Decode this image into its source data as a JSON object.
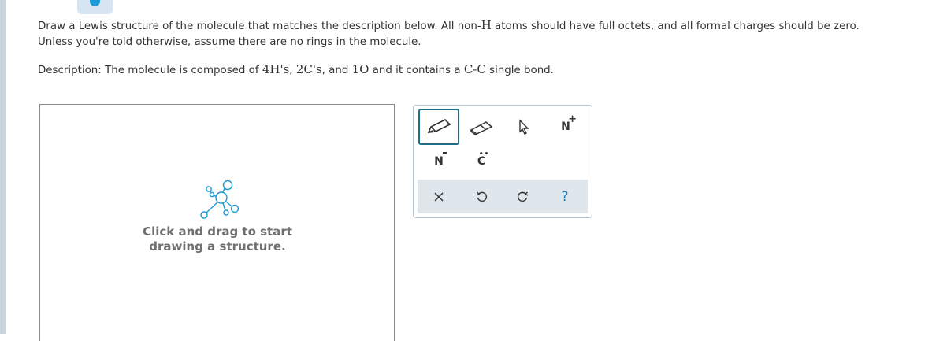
{
  "instructions": {
    "line1_a": "Draw a Lewis structure of the molecule that matches the description below. All non-",
    "line1_h": "H",
    "line1_b": " atoms should have full octets, and all formal charges should be zero.",
    "line2": "Unless you're told otherwise, assume there are no rings in the molecule.",
    "desc_a": "Description: The molecule is composed of ",
    "desc_h": "4H's",
    "desc_sep1": ", ",
    "desc_c": "2C's",
    "desc_sep2": ", and ",
    "desc_o": "1O",
    "desc_b": " and it contains a ",
    "desc_bond": "C-C",
    "desc_c2": " single bond."
  },
  "canvas": {
    "placeholder_line1": "Click and drag to start",
    "placeholder_line2": "drawing a structure."
  },
  "toolbar": {
    "tools": [
      {
        "id": "pencil",
        "icon": "pencil-icon",
        "active": true
      },
      {
        "id": "eraser",
        "icon": "eraser-icon"
      },
      {
        "id": "select",
        "icon": "cursor-icon"
      },
      {
        "id": "positive-charge",
        "label": "N",
        "superscript": "+"
      },
      {
        "id": "lone-pair",
        "label": "N"
      },
      {
        "id": "radical",
        "label": "C"
      }
    ],
    "actions": [
      {
        "id": "clear",
        "icon": "x-icon"
      },
      {
        "id": "undo",
        "icon": "undo-icon"
      },
      {
        "id": "redo",
        "icon": "redo-icon"
      },
      {
        "id": "help",
        "label": "?"
      }
    ],
    "colors": {
      "accent": "#1e6f87",
      "help": "#1a7fb5",
      "bottom_bg": "#dfe6ec"
    }
  }
}
